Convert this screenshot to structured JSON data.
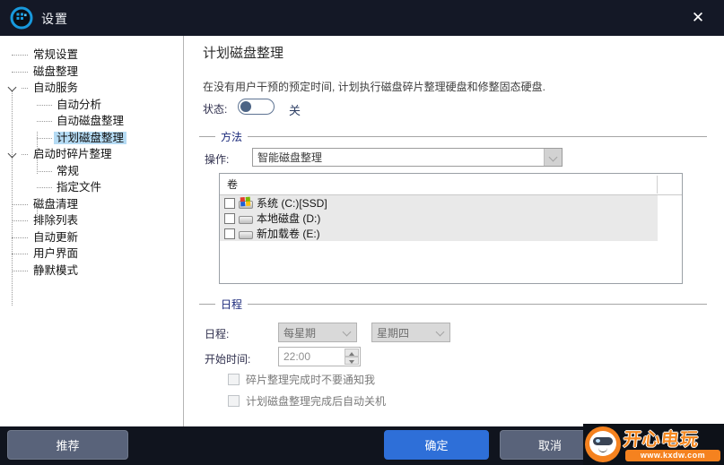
{
  "window": {
    "title": "设置",
    "close_icon": "✕"
  },
  "sidebar": {
    "items": [
      {
        "label": "常规设置"
      },
      {
        "label": "磁盘整理"
      },
      {
        "label": "自动服务"
      },
      {
        "label": "自动分析"
      },
      {
        "label": "自动磁盘整理"
      },
      {
        "label": "计划磁盘整理"
      },
      {
        "label": "启动时碎片整理"
      },
      {
        "label": "常规"
      },
      {
        "label": "指定文件"
      },
      {
        "label": "磁盘清理"
      },
      {
        "label": "排除列表"
      },
      {
        "label": "自动更新"
      },
      {
        "label": "用户界面"
      },
      {
        "label": "静默模式"
      }
    ],
    "selected": "计划磁盘整理"
  },
  "main": {
    "title": "计划磁盘整理",
    "description": "在没有用户干预的预定时间, 计划执行磁盘碎片整理硬盘和修整固态硬盘.",
    "status": {
      "label": "状态:",
      "value": "关",
      "state": "off"
    },
    "method": {
      "group_label": "方法",
      "operation_label": "操作:",
      "operation_value": "智能磁盘整理",
      "volumes": {
        "header": "卷",
        "rows": [
          {
            "label": "系统 (C:)[SSD]",
            "checked": false,
            "icon": "system-drive-icon"
          },
          {
            "label": "本地磁盘 (D:)",
            "checked": false,
            "icon": "drive-icon"
          },
          {
            "label": "新加载卷 (E:)",
            "checked": false,
            "icon": "drive-icon"
          }
        ]
      }
    },
    "schedule": {
      "group_label": "日程",
      "schedule_label": "日程:",
      "frequency_value": "每星期",
      "day_value": "星期四",
      "start_label": "开始时间:",
      "start_value": "22:00",
      "checkbox_notify": "碎片整理完成时不要通知我",
      "checkbox_shutdown": "计划磁盘整理完成后自动关机"
    }
  },
  "footer": {
    "recommend": "推荐",
    "ok": "确定",
    "cancel": "取消"
  },
  "watermark": {
    "title": "开心电玩",
    "url": "www.kxdw.com"
  },
  "colors": {
    "titlebar_bg": "#141826",
    "footer_bg": "#10141e",
    "accent_blue": "#2e6fd8",
    "slate_button": "#59637a",
    "tree_selection": "#b5dbf4",
    "group_label": "#1b2a7b",
    "toggle_knob": "#4c6485",
    "logo_blue": "#1899dd",
    "watermark_orange": "#f5821f"
  }
}
